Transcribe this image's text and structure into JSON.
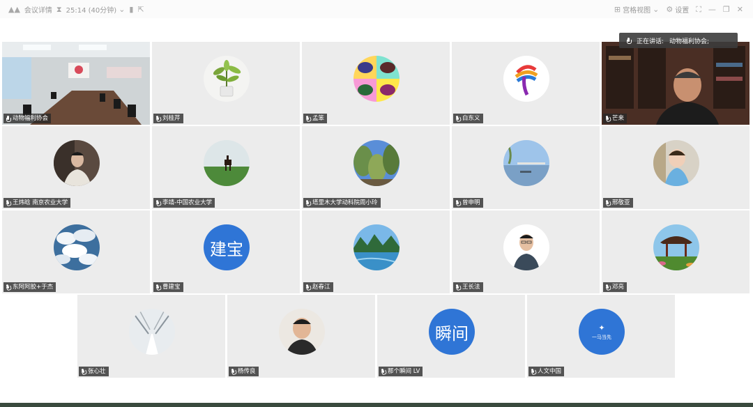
{
  "topbar": {
    "meeting_details": "会议详情",
    "timer": "25:14 (40分钟)",
    "gallery_view": "宫格视图",
    "settings": "设置"
  },
  "speaking": {
    "prefix": "正在讲话:",
    "name": "动物福利协会;"
  },
  "participants": [
    {
      "name": "动物福利协会",
      "kind": "room-video",
      "active": true
    },
    {
      "name": "刘桂芹",
      "kind": "plant"
    },
    {
      "name": "孟笨",
      "kind": "quad"
    },
    {
      "name": "白东义",
      "kind": "logo"
    },
    {
      "name": "芒来",
      "kind": "person-video"
    },
    {
      "name": "王炜晗 南京农业大学",
      "kind": "portrait"
    },
    {
      "name": "李靖-中国农业大学",
      "kind": "field"
    },
    {
      "name": "塔里木大学动科院周小玲",
      "kind": "trees"
    },
    {
      "name": "曾申明",
      "kind": "lake"
    },
    {
      "name": "邢敬亚",
      "kind": "child"
    },
    {
      "name": "东阿阿胶+于杰",
      "kind": "clouds"
    },
    {
      "name": "曹建宝",
      "kind": "text",
      "avatar_text": "建宝"
    },
    {
      "name": "赵春江",
      "kind": "river"
    },
    {
      "name": "王长法",
      "kind": "idphoto"
    },
    {
      "name": "邓亮",
      "kind": "pavilion"
    },
    {
      "name": "张心壮",
      "kind": "snow"
    },
    {
      "name": "杨传良",
      "kind": "man"
    },
    {
      "name": "那个瞬间 LV",
      "kind": "text",
      "avatar_text": "瞬间"
    },
    {
      "name": "人文中国",
      "kind": "brand",
      "avatar_text": "一马当先"
    }
  ],
  "colors": {
    "active_border": "#2bc48a",
    "text_avatar": "#2f75d6"
  }
}
